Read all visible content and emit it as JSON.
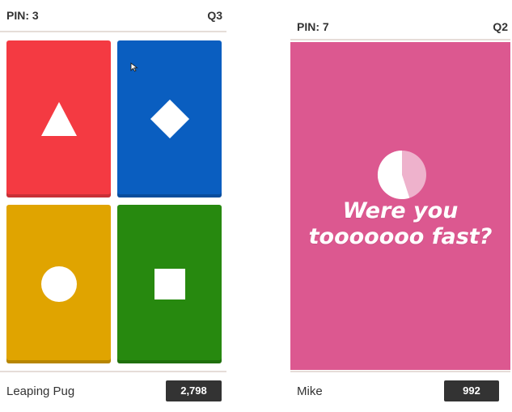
{
  "left_screen": {
    "pin_label": "PIN: 3",
    "question_label": "Q3",
    "answer_tiles": [
      {
        "color": "#f43a42",
        "shape": "triangle-icon"
      },
      {
        "color": "#0a5ec0",
        "shape": "diamond-icon"
      },
      {
        "color": "#e0a400",
        "shape": "circle-icon"
      },
      {
        "color": "#27890f",
        "shape": "square-icon"
      }
    ],
    "player_name": "Leaping Pug",
    "score": "2,798"
  },
  "right_screen": {
    "pin_label": "PIN: 7",
    "question_label": "Q2",
    "feedback_color": "#dc5890",
    "timer_icon": "timer-pie-icon",
    "feedback_text": "Were you\ntooooooo fast?",
    "player_name": "Mike",
    "score": "992"
  }
}
